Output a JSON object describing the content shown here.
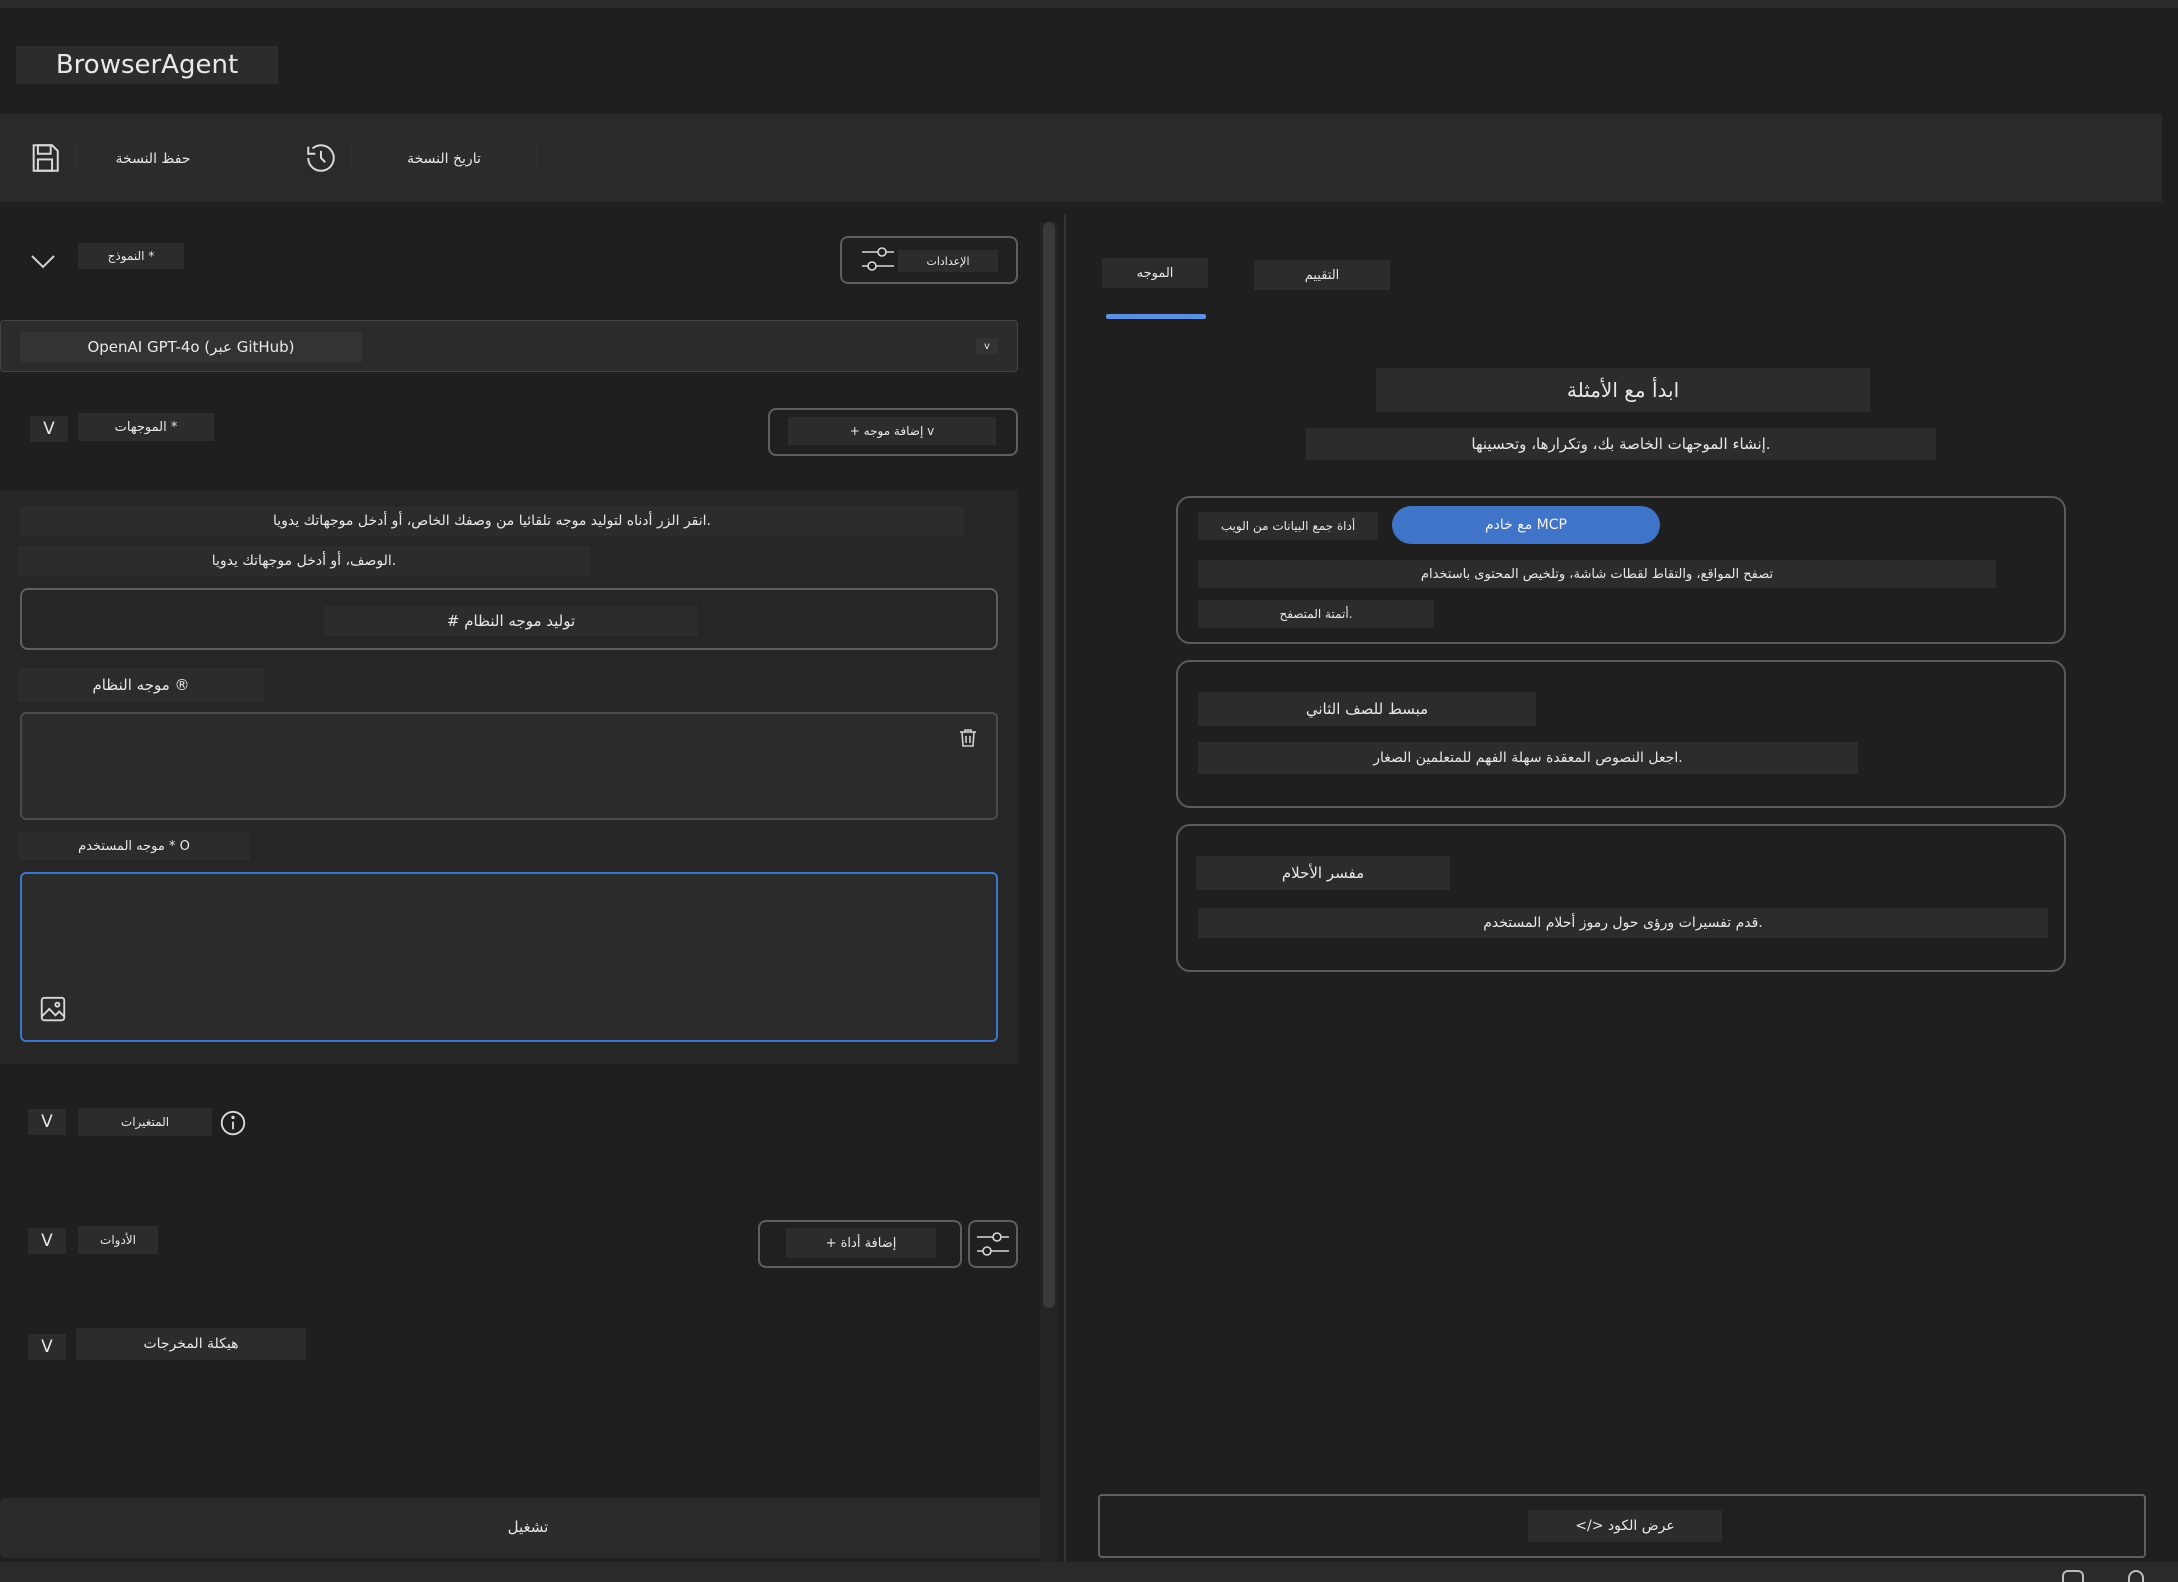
{
  "app": {
    "title": "BrowserAgent"
  },
  "toolbar": {
    "save_label": "حفظ النسخة",
    "history_label": "تاريخ النسخة"
  },
  "left": {
    "model_label": "النموذج *",
    "settings_label": "الإعدادات",
    "model_value": "OpenAI GPT-4o (عبر GitHub)",
    "prompts_label": "الموجهات *",
    "add_prompt_label": "+ إضافة موجه v",
    "hint_line1": "انقر الزر أدناه لتوليد موجه تلقائيا من وصفك الخاص، أو أدخل موجهاتك يدويا.",
    "hint_line2": "الوصف، أو أدخل موجهاتك يدويا.",
    "generate_label": "# توليد موجه النظام",
    "system_prompt_label": "موجه النظام ®",
    "user_prompt_label": "موجه المستخدم * O",
    "variables_label": "المتغيرات",
    "tools_label": "الأدوات",
    "add_tool_label": "+ إضافة أداة",
    "output_label": "هيكلة المخرجات",
    "run_label": "تشغيل",
    "collapse_glyph": "V"
  },
  "right": {
    "tabs": [
      {
        "label": "الموجه",
        "active": true
      },
      {
        "label": "التقييم",
        "active": false
      }
    ],
    "examples_title": "ابدأ مع الأمثلة",
    "examples_subtitle": "إنشاء الموجهات الخاصة بك، وتكرارها، وتحسينها.",
    "cards": [
      {
        "tag": "أداة جمع البيانات من الويب",
        "pill": "مع خادم MCP",
        "desc": "تصفح المواقع، والتقاط لقطات شاشة، وتلخيص المحتوى باستخدام",
        "desc2": "أتمتة المتصفح."
      },
      {
        "title": "مبسط للصف الثاني",
        "desc": "اجعل النصوص المعقدة سهلة الفهم للمتعلمين الصغار."
      },
      {
        "title": "مفسر الأحلام",
        "desc": "قدم تفسيرات ورؤى حول رموز أحلام المستخدم."
      }
    ],
    "view_code_label": "</> عرض الكود"
  },
  "colors": {
    "accent": "#3f74c9",
    "tab_underline": "#5b8fe0",
    "bg": "#1f1f1f"
  }
}
